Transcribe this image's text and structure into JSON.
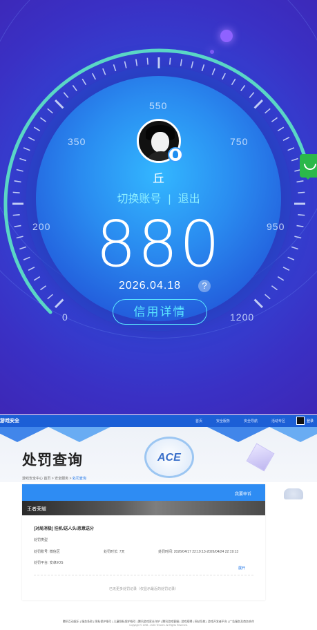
{
  "gauge": {
    "scale_labels": [
      "0",
      "200",
      "350",
      "550",
      "750",
      "950",
      "1200"
    ],
    "user_name": "丘",
    "switch_account": "切换账号",
    "separator": "|",
    "logout": "退出",
    "score": "880",
    "date": "2026.04.18",
    "help": "?",
    "detail_button": "信用详情",
    "colors": {
      "accent": "#5be7ff",
      "arc": "#5ad6c6",
      "bg": "#3a30c4"
    }
  },
  "site": {
    "logo": "游戏安全",
    "nav": [
      "首页",
      "安全服务",
      "安全导航",
      "活动专区"
    ],
    "login": "登录"
  },
  "page": {
    "title": "处罚查询",
    "ace": "ACE",
    "breadcrumb": {
      "home": "游戏安全中心",
      "path": "首页 > 安全服务 >",
      "current": "处罚查询"
    },
    "appeal": "我要申诉",
    "game": "王者荣耀",
    "record": {
      "title": "[对局消极] 挂机/送人头/恶意送分",
      "type": "处罚类型",
      "account": "处罚账号: 微信区",
      "duration": "处罚时长: 7天",
      "period": "处罚时间: 2026/04/17 22:19:13-2026/04/24 22:19:13",
      "platform": "处罚平台: 安卓/iOS",
      "expand": "展开"
    },
    "more": "已无更多处罚记录（仅显示最近的处罚记录）"
  },
  "footer": {
    "links": "腾讯互动娱乐 | 服务条款 | 隐私保护指引 | 儿童隐私保护指引 | 腾讯游戏家长守护 | 腾讯游戏客服 | 游戏招聘 | 网站导航 | 游戏开发者平台 | 广告服务及商务合作",
    "copy": "Copyright © 1998 - 2026 Tencent. All Rights Reserved."
  }
}
